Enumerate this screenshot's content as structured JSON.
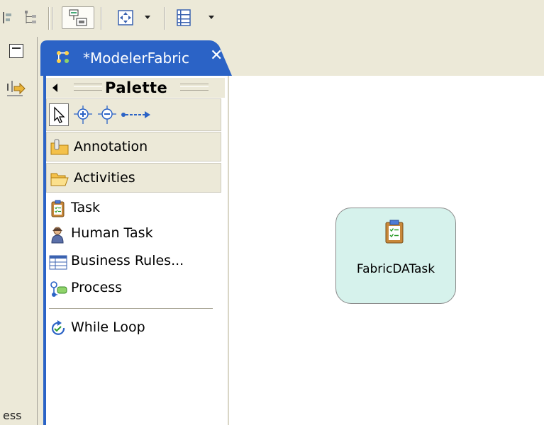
{
  "toolbar": {
    "buttons": [
      {
        "name": "align-left-icon"
      },
      {
        "name": "hierarchy-icon"
      },
      {
        "name": "node-layout-icon",
        "pressed": true
      },
      {
        "name": "zoom-fit-icon",
        "has_dropdown": true
      },
      {
        "name": "list-view-icon",
        "has_dropdown": true
      }
    ]
  },
  "left_strip": {
    "cut_label": "ess"
  },
  "editor": {
    "tab_title": "*ModelerFabric",
    "tab_close": "✕"
  },
  "palette": {
    "title": "Palette",
    "tools": [
      "select-arrow-icon",
      "zoom-in-icon",
      "zoom-out-icon",
      "connection-icon"
    ],
    "drawers": [
      {
        "label": "Annotation",
        "icon": "annotation-folder-icon"
      },
      {
        "label": "Activities",
        "icon": "open-folder-icon"
      }
    ],
    "entries": [
      {
        "label": "Task",
        "icon": "task-clipboard-icon"
      },
      {
        "label": "Human Task",
        "icon": "person-icon"
      },
      {
        "label": "Business Rules...",
        "icon": "table-icon"
      },
      {
        "label": "Process",
        "icon": "process-icon"
      },
      {
        "label": "While Loop",
        "icon": "loop-icon"
      }
    ]
  },
  "canvas": {
    "node_label": "FabricDATask",
    "node_icon": "task-clipboard-icon",
    "node_color": "#d6f2ec"
  },
  "colors": {
    "tab_blue": "#2b63c6",
    "chrome": "#ece9d8"
  }
}
